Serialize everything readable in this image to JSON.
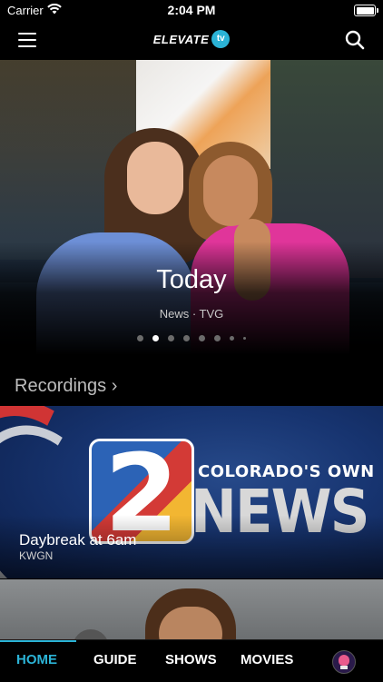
{
  "status_bar": {
    "carrier": "Carrier",
    "time": "2:04 PM"
  },
  "header": {
    "logo_text": "ELEVATE",
    "logo_badge": "tv"
  },
  "hero": {
    "title": "Today",
    "meta": "News · TVG",
    "page_count": 8,
    "active_index": 1
  },
  "recordings": {
    "heading": "Recordings ›",
    "items": [
      {
        "title": "Daybreak at 6am",
        "channel": "KWGN",
        "logo_number": "2",
        "logo_tagline": "COLORADO'S OWN",
        "logo_word": "NEWS"
      }
    ]
  },
  "tabbar": {
    "tabs": [
      {
        "label": "HOME",
        "active": true
      },
      {
        "label": "GUIDE",
        "active": false
      },
      {
        "label": "SHOWS",
        "active": false
      },
      {
        "label": "MOVIES",
        "active": false
      }
    ]
  },
  "colors": {
    "accent": "#2bb3d6",
    "background": "#000000"
  },
  "icons": [
    "wifi-icon",
    "battery-icon",
    "menu-icon",
    "search-icon",
    "chevron-right-icon",
    "avatar"
  ]
}
